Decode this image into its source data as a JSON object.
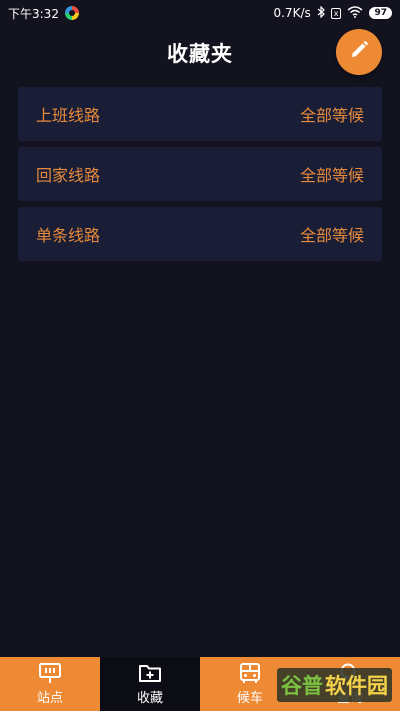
{
  "status_bar": {
    "time": "下午3:32",
    "speed": "0.7K/s",
    "bluetooth_icon": "bluetooth-icon",
    "box_label": "x",
    "wifi_icon": "wifi-icon",
    "battery": "97"
  },
  "header": {
    "title": "收藏夹",
    "edit_icon": "pencil-icon"
  },
  "routes": [
    {
      "name": "上班线路",
      "action": "全部等候"
    },
    {
      "name": "回家线路",
      "action": "全部等候"
    },
    {
      "name": "单条线路",
      "action": "全部等候"
    }
  ],
  "nav": {
    "items": [
      {
        "label": "站点",
        "icon": "station-board-icon"
      },
      {
        "label": "收藏",
        "icon": "folder-plus-icon"
      },
      {
        "label": "候车",
        "icon": "bus-icon"
      },
      {
        "label": "查询",
        "icon": "search-icon"
      }
    ],
    "active_index": 1
  },
  "watermark": {
    "part1": "谷普",
    "part2": "软件园"
  },
  "colors": {
    "background": "#13131f",
    "accent": "#ee8a34",
    "card": "#1a1d36",
    "card_text": "#e68a3c"
  }
}
